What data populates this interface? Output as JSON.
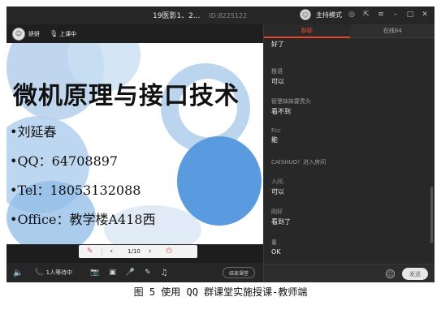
{
  "window": {
    "title": "19医影1、2...",
    "room_id": "ID:8225122",
    "host_mode": "主持模式"
  },
  "teacher": {
    "name": "妍妍",
    "status": "上课中"
  },
  "slide": {
    "title": "微机原理与接口技术",
    "lines": [
      "•刘延春",
      "•QQ：64708897",
      "•Tel：18053132088",
      "•Office：教学楼A418西"
    ]
  },
  "pager": {
    "page": "1/10"
  },
  "bottom": {
    "waiting": "1人等待中",
    "end_class": "结束课堂"
  },
  "tabs": [
    {
      "label": "群聊"
    },
    {
      "label": "在线84"
    }
  ],
  "chat": [
    {
      "sender": "",
      "text": "好了"
    },
    {
      "sender": "橙语",
      "text": "可以"
    },
    {
      "sender": "智慧妹妹要秃头",
      "text": "看不到"
    },
    {
      "sender": "Fcc",
      "text": "能"
    },
    {
      "system": "CAISHUO！进入房间"
    },
    {
      "sender": "人间.",
      "text": "可以"
    },
    {
      "sender": "刚好",
      "text": "看到了"
    },
    {
      "sender": "董",
      "text": "OK"
    }
  ],
  "input": {
    "send_label": "发送"
  },
  "caption": "图 5 使用 QQ 群课堂实施授课-教师端",
  "colors": {
    "accent": "#e2452e",
    "slide_circle": "#4a90d9"
  }
}
